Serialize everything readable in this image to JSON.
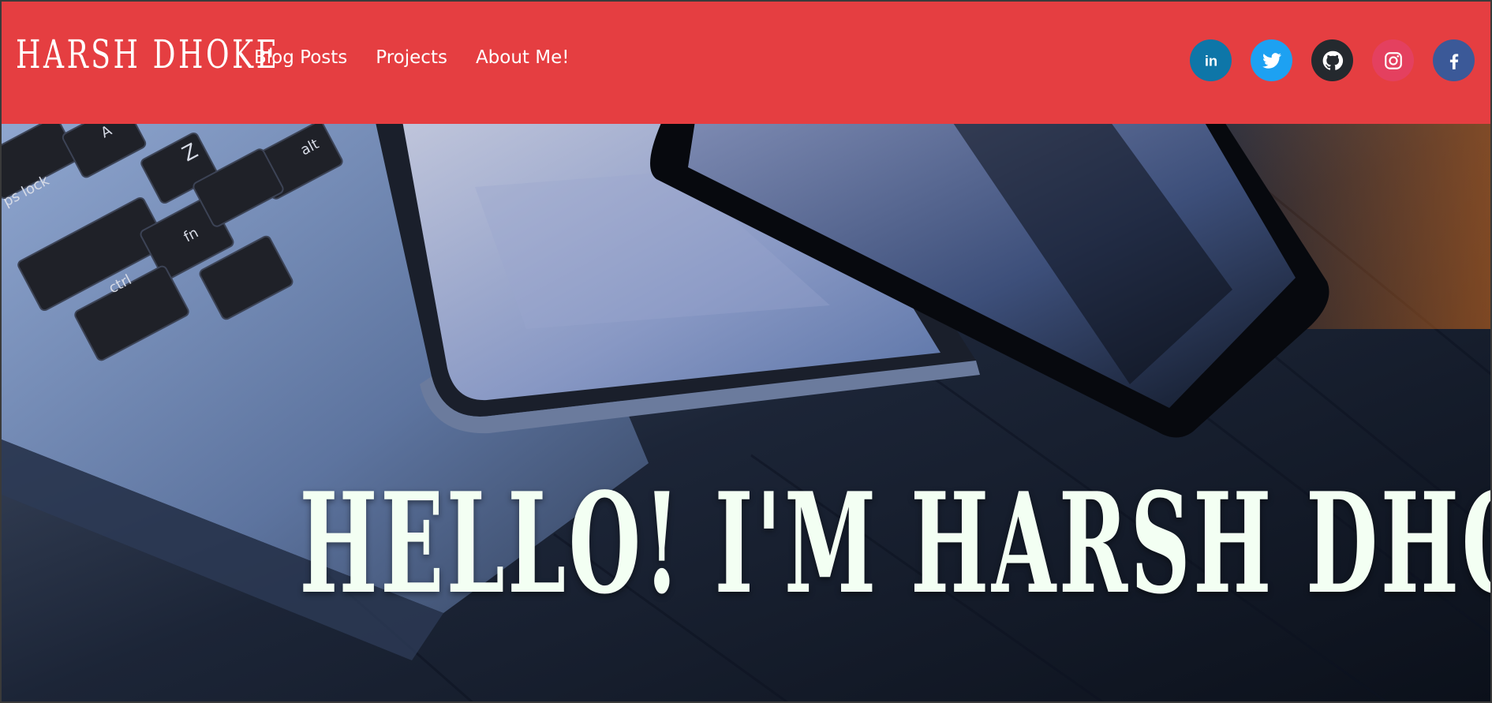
{
  "brand": {
    "name": "Harsh Dhoke"
  },
  "nav": {
    "links": [
      {
        "label": "Blog Posts"
      },
      {
        "label": "Projects"
      },
      {
        "label": "About Me!"
      }
    ]
  },
  "socials": [
    {
      "name": "LinkedIn",
      "icon": "linkedin-icon",
      "color": "#0e76a8"
    },
    {
      "name": "Twitter",
      "icon": "twitter-icon",
      "color": "#1da1f2"
    },
    {
      "name": "GitHub",
      "icon": "github-icon",
      "color": "#24292e"
    },
    {
      "name": "Instagram",
      "icon": "instagram-icon",
      "color": "#e4405f"
    },
    {
      "name": "Facebook",
      "icon": "facebook-icon",
      "color": "#3b5998"
    }
  ],
  "hero": {
    "title": "Hello! I'm Harsh Dhoke.",
    "image_subject": "laptop-keyboard-tablet-and-phone-on-wooden-desk",
    "keys": [
      "ps lock",
      "A",
      "Z",
      "alt",
      "fn",
      "ctrl"
    ]
  },
  "colors": {
    "navbar": "#e53e41",
    "hero_text": "#f3fff3"
  }
}
